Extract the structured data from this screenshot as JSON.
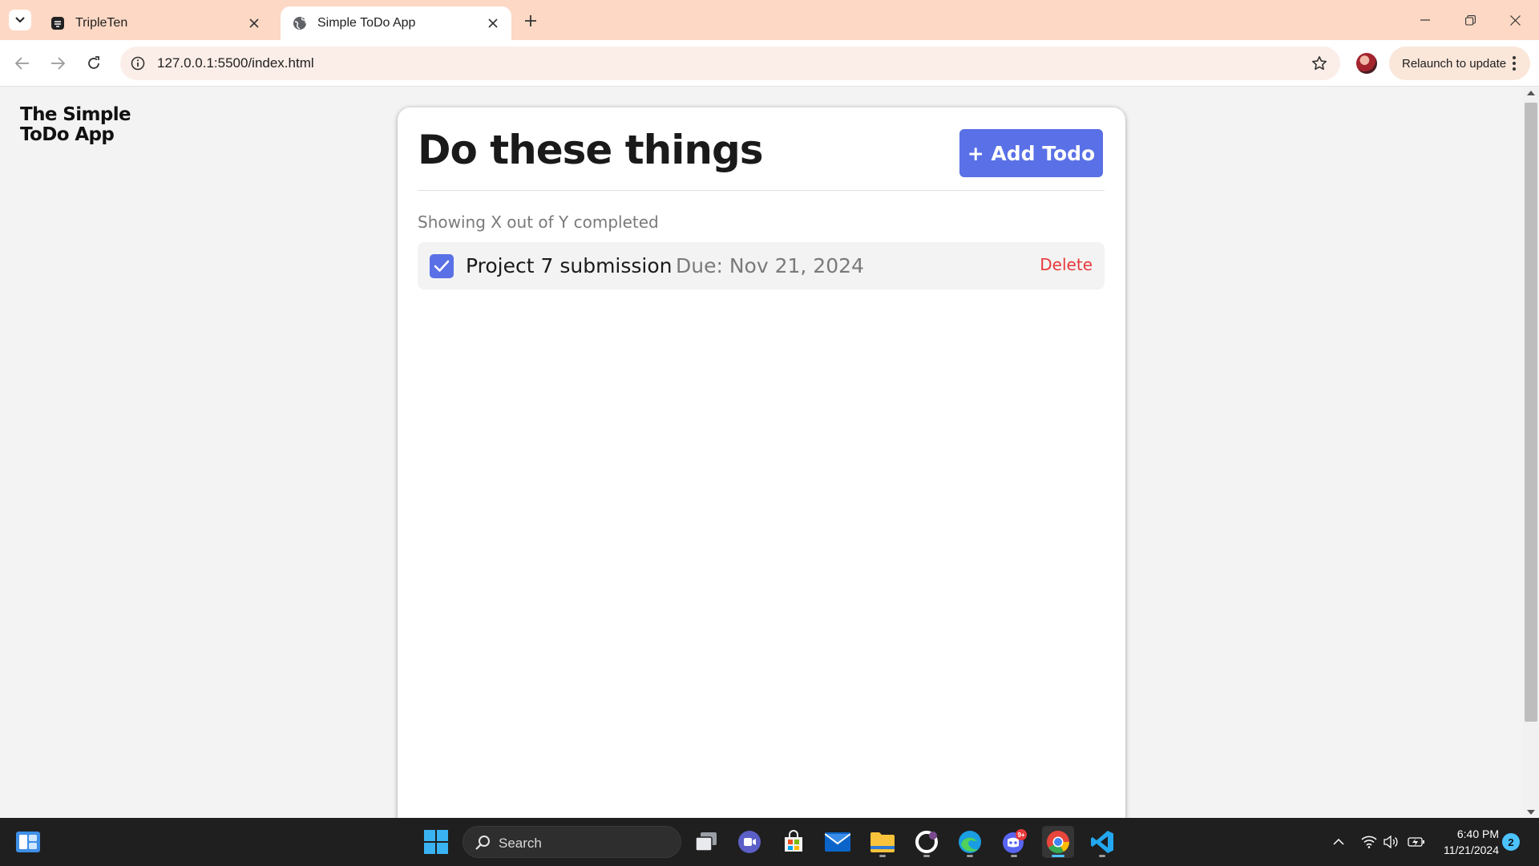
{
  "browser": {
    "tabs": [
      {
        "title": "TripleTen",
        "active": false
      },
      {
        "title": "Simple ToDo App",
        "active": true
      }
    ],
    "url": "127.0.0.1:5500/index.html",
    "relaunch_label": "Relaunch to update"
  },
  "page": {
    "logo": "The Simple ToDo App",
    "title": "Do these things",
    "add_button": "+ Add Todo",
    "counter_text": "Showing X out of Y completed",
    "todos": [
      {
        "name": "Project 7 submission",
        "due": "Due: Nov 21, 2024",
        "completed": true,
        "delete_label": "Delete"
      }
    ]
  },
  "taskbar": {
    "search_label": "Search",
    "time": "6:40 PM",
    "date": "11/21/2024",
    "notification_count": "2",
    "discord_badge": "9+",
    "apps": [
      "task-view",
      "teams-meet",
      "microsoft-store",
      "mail",
      "file-explorer",
      "github-desktop",
      "edge",
      "discord",
      "chrome",
      "vscode"
    ]
  },
  "colors": {
    "accent": "#5970e6",
    "danger": "#e8393b",
    "tabstrip": "#fdd8c4",
    "taskbar": "#1f1f1f"
  }
}
